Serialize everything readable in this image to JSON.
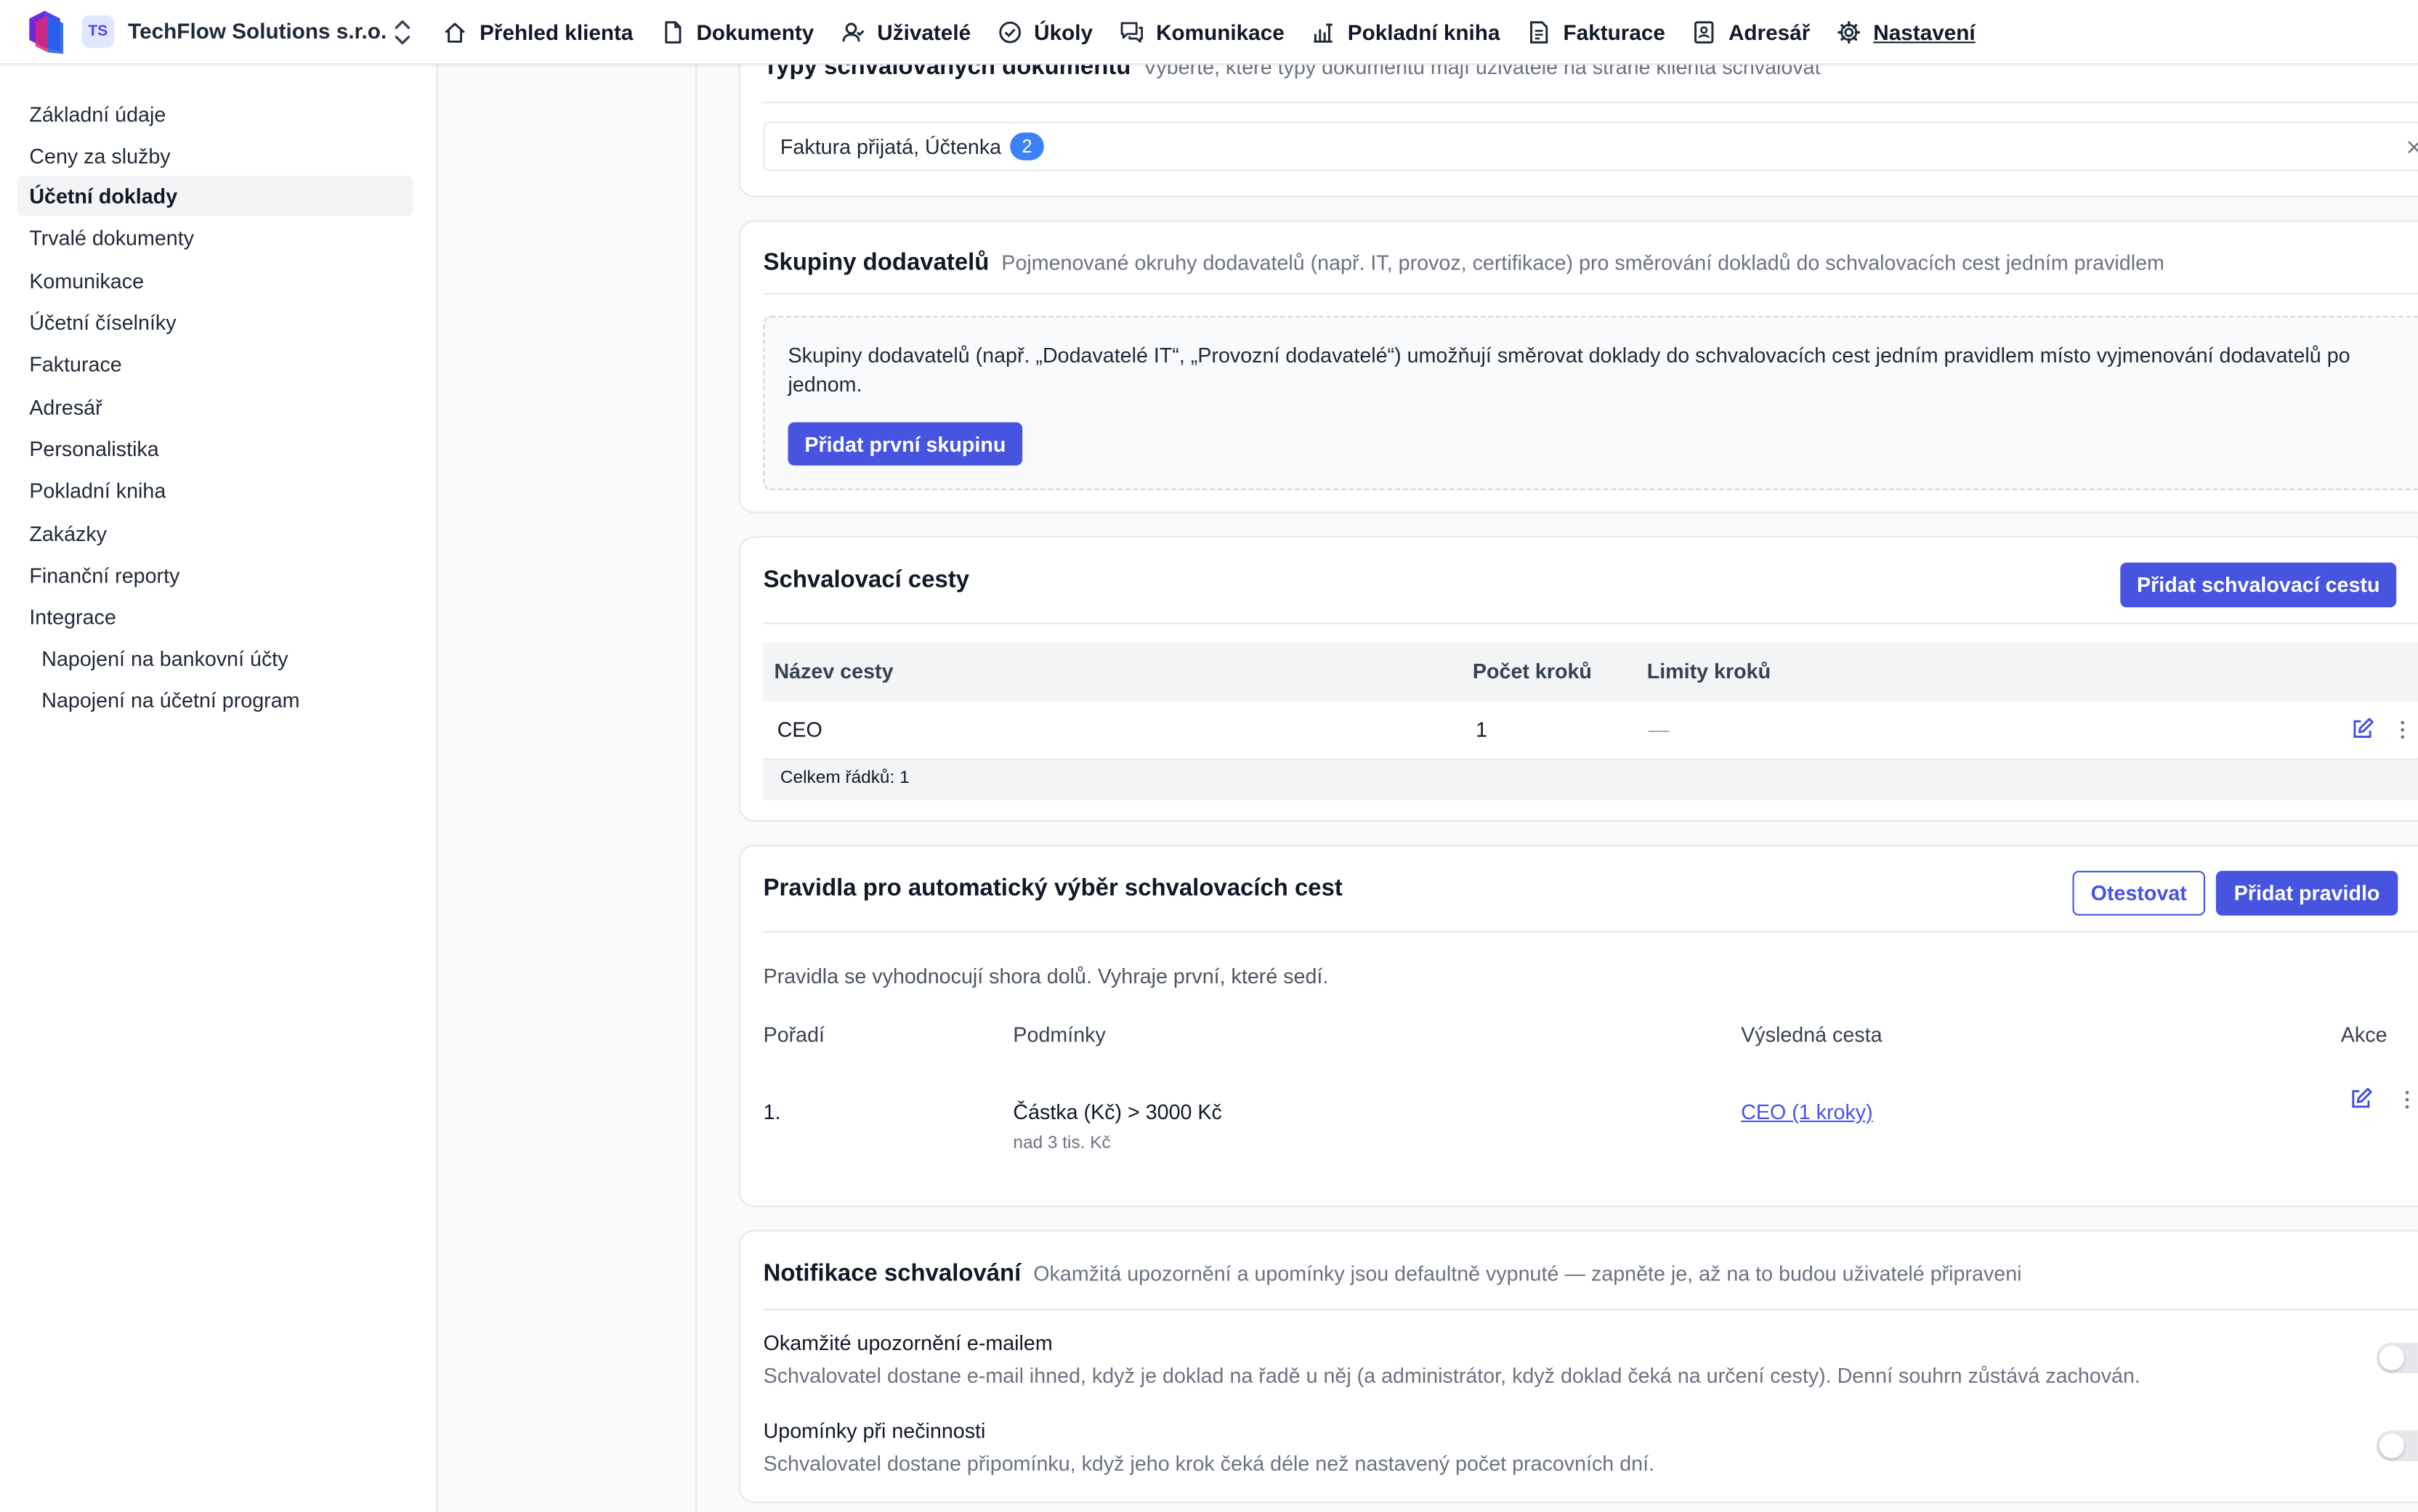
{
  "org": {
    "initials": "TS",
    "name": "TechFlow Solutions s.r.o."
  },
  "nav": [
    {
      "label": "Přehled klienta",
      "icon": "home-icon"
    },
    {
      "label": "Dokumenty",
      "icon": "document-icon"
    },
    {
      "label": "Uživatelé",
      "icon": "users-icon"
    },
    {
      "label": "Úkoly",
      "icon": "check-circle-icon"
    },
    {
      "label": "Komunikace",
      "icon": "chat-icon"
    },
    {
      "label": "Pokladní kniha",
      "icon": "cash-book-icon"
    },
    {
      "label": "Fakturace",
      "icon": "invoice-icon"
    },
    {
      "label": "Adresář",
      "icon": "contacts-icon"
    },
    {
      "label": "Nastavení",
      "icon": "gear-icon",
      "active": true
    }
  ],
  "sidebar": [
    {
      "label": "Základní údaje"
    },
    {
      "label": "Ceny za služby"
    },
    {
      "label": "Účetní doklady",
      "active": true
    },
    {
      "label": "Trvalé dokumenty"
    },
    {
      "label": "Komunikace"
    },
    {
      "label": "Účetní číselníky"
    },
    {
      "label": "Fakturace"
    },
    {
      "label": "Adresář"
    },
    {
      "label": "Personalistika"
    },
    {
      "label": "Pokladní kniha"
    },
    {
      "label": "Zakázky"
    },
    {
      "label": "Finanční reporty"
    },
    {
      "label": "Integrace"
    },
    {
      "label": "Napojení na bankovní účty",
      "sub": true
    },
    {
      "label": "Napojení na účetní program",
      "sub": true
    }
  ],
  "doc_types": {
    "title": "Typy schvalovaných dokumentů",
    "desc": "Vyberte, které typy dokumentů mají uživatelé na straně klienta schvalovat",
    "value": "Faktura přijatá, Účtenka",
    "count": "2"
  },
  "supplier_groups": {
    "title": "Skupiny dodavatelů",
    "desc": "Pojmenované okruhy dodavatelů (např. IT, provoz, certifikace) pro směrování dokladů do schvalovacích cest jedním pravidlem",
    "info": "Skupiny dodavatelů (např. „Dodavatelé IT“, „Provozní dodavatelé“) umožňují směrovat doklady do schvalovacích cest jedním pravidlem místo vyjmenování dodavatelů po jednom.",
    "button": "Přidat první skupinu"
  },
  "paths": {
    "title": "Schvalovací cesty",
    "button": "Přidat schvalovací cestu",
    "columns": [
      "Název cesty",
      "Počet kroků",
      "Limity kroků"
    ],
    "rows": [
      {
        "name": "CEO",
        "steps": "1",
        "limits": "—"
      }
    ],
    "footer": "Celkem řádků: 1"
  },
  "rules": {
    "title": "Pravidla pro automatický výběr schvalovacích cest",
    "test_button": "Otestovat",
    "add_button": "Přidat pravidlo",
    "note": "Pravidla se vyhodnocují shora dolů. Vyhraje první, které sedí.",
    "columns": [
      "Pořadí",
      "Podmínky",
      "Výsledná cesta",
      "Akce"
    ],
    "rows": [
      {
        "order": "1.",
        "condition": "Částka (Kč) > 3000 Kč",
        "condition_sub": "nad 3 tis. Kč",
        "path": "CEO (1 kroky)"
      }
    ]
  },
  "notifications": {
    "title": "Notifikace schvalování",
    "desc": "Okamžitá upozornění a upomínky jsou defaultně vypnuté — zapněte je, až na to budou uživatelé připraveni",
    "items": [
      {
        "title": "Okamžité upozornění e-mailem",
        "desc": "Schvalovatel dostane e-mail ihned, když je doklad na řadě u něj (a administrátor, když doklad čeká na určení cesty). Denní souhrn zůstává zachován.",
        "enabled": false
      },
      {
        "title": "Upomínky při nečinnosti",
        "desc": "Schvalovatel dostane připomínku, když jeho krok čeká déle než nastavený počet pracovních dní.",
        "enabled": false
      }
    ]
  },
  "colors": {
    "primary": "#4654e0",
    "badge": "#3b82f6"
  }
}
